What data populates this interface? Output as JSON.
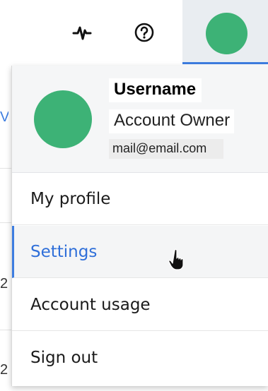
{
  "topbar": {
    "activity_icon": "activity-pulse-icon",
    "help_icon": "question-circle-icon",
    "avatar_color": "#3db276",
    "active_tab_color": "#3d7de0"
  },
  "background": {
    "glyphs": [
      "V",
      "2",
      "2"
    ]
  },
  "account": {
    "username": "Username",
    "role": "Account Owner",
    "email": "mail@email.com",
    "avatar_color": "#3db276"
  },
  "menu": {
    "items": [
      {
        "label": "My profile"
      },
      {
        "label": "Settings",
        "active": true
      },
      {
        "label": "Account usage"
      },
      {
        "label": "Sign out"
      }
    ],
    "accent_color": "#2f6fd9"
  },
  "cursor": "hand-pointer-icon"
}
